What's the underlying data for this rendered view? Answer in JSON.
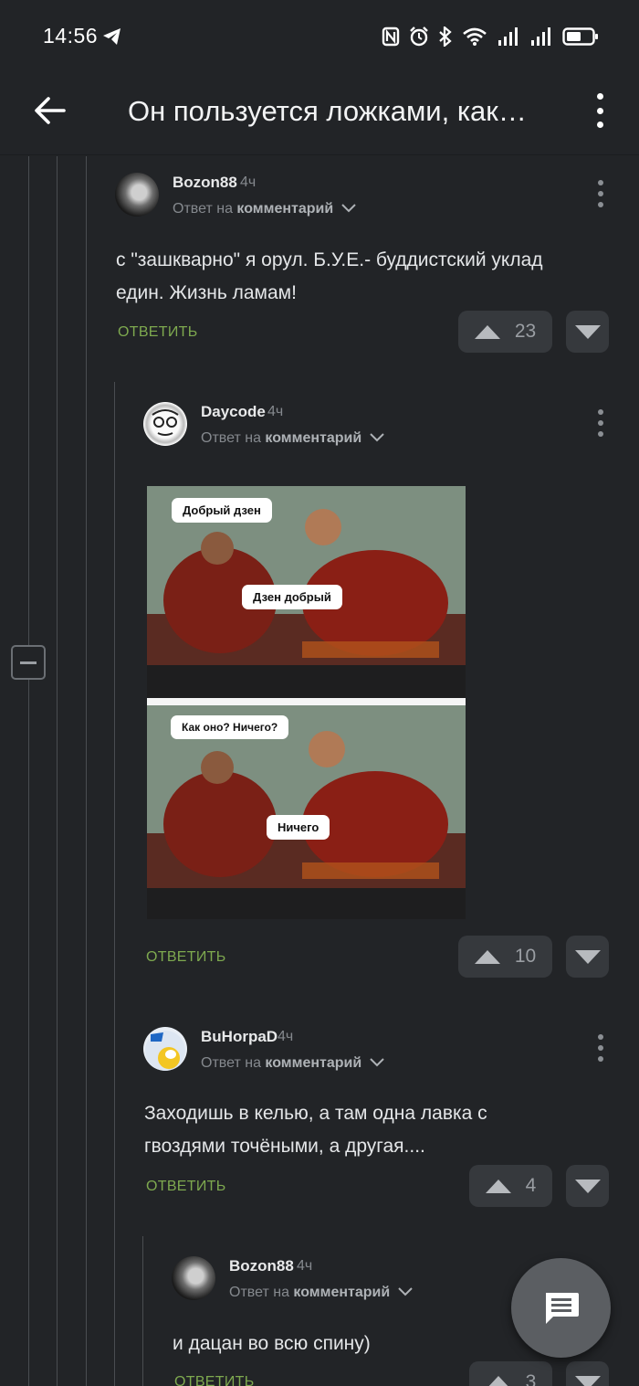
{
  "status_bar": {
    "time": "14:56"
  },
  "app_bar": {
    "title": "Он пользуется ложками, как…"
  },
  "comments": [
    {
      "username": "Bozon88",
      "time": "4ч",
      "reply_prefix": "Ответ на",
      "reply_target": "комментарий",
      "text": "с \"зашкварно\" я орул. Б.У.Е.- буддистский уклад един. Жизнь ламам!",
      "reply_label": "ОТВЕТИТЬ",
      "votes": "23"
    },
    {
      "username": "Daycode",
      "time": "4ч",
      "reply_prefix": "Ответ на",
      "reply_target": "комментарий",
      "meme": {
        "top_bubble_1": "Добрый дзен",
        "top_bubble_2": "Дзен добрый",
        "bottom_bubble_1": "Как оно? Ничего?",
        "bottom_bubble_2": "Ничего"
      },
      "reply_label": "ОТВЕТИТЬ",
      "votes": "10"
    },
    {
      "username": "BuHorpaD",
      "time": "4ч",
      "reply_prefix": "Ответ на",
      "reply_target": "комментарий",
      "text": "Заходишь в келью, а там одна лавка с гвоздями точёными, а другая....",
      "reply_label": "ОТВЕТИТЬ",
      "votes": "4"
    },
    {
      "username": "Bozon88",
      "time": "4ч",
      "reply_prefix": "Ответ на",
      "reply_target": "комментарий",
      "text": "и дацан во всю спину)",
      "reply_label": "ОТВЕТИТЬ",
      "votes": "3"
    }
  ],
  "colors": {
    "background": "#222427",
    "accent_green": "#7ea94f",
    "vote_bg": "#36393d"
  }
}
